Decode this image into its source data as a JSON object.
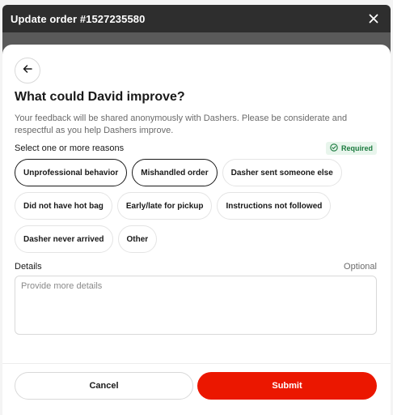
{
  "window": {
    "title": "Update order #1527235580"
  },
  "modal": {
    "heading": "What could David improve?",
    "description": "Your feedback will be shared anonymously with Dashers. Please be considerate and respectful as you help Dashers improve.",
    "reasons_label": "Select one or more reasons",
    "required_badge": "Required",
    "reasons": [
      {
        "label": "Unprofessional behavior",
        "selected": true
      },
      {
        "label": "Mishandled order",
        "selected": true
      },
      {
        "label": "Dasher sent someone else",
        "selected": false
      },
      {
        "label": "Did not have hot bag",
        "selected": false
      },
      {
        "label": "Early/late for pickup",
        "selected": false
      },
      {
        "label": "Instructions not followed",
        "selected": false
      },
      {
        "label": "Dasher never arrived",
        "selected": false
      },
      {
        "label": "Other",
        "selected": false
      }
    ],
    "details_label": "Details",
    "optional_label": "Optional",
    "details_placeholder": "Provide more details",
    "details_value": ""
  },
  "footer": {
    "cancel_label": "Cancel",
    "submit_label": "Submit"
  },
  "colors": {
    "accent": "#eb1700",
    "window_bar": "#2e2e2e",
    "required_text": "#1b7a3e",
    "required_bg": "#e8f5ec"
  },
  "icons": [
    "close-icon",
    "back-arrow-icon",
    "check-circle-icon"
  ]
}
